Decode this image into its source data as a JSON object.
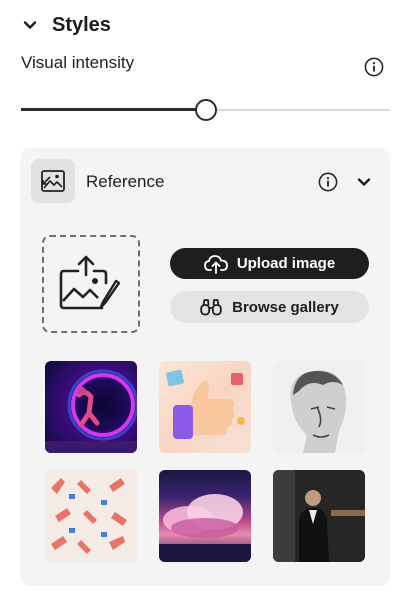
{
  "styles": {
    "title": "Styles",
    "visual_intensity_label": "Visual intensity",
    "slider_value": 0.5
  },
  "reference": {
    "label": "Reference",
    "upload_button": "Upload image",
    "browse_button": "Browse gallery",
    "gallery": [
      {
        "name": "neon-dancer"
      },
      {
        "name": "3d-thumbs-up"
      },
      {
        "name": "sketch-portrait"
      },
      {
        "name": "hand-pattern"
      },
      {
        "name": "pink-clouds"
      },
      {
        "name": "man-in-suit"
      }
    ]
  },
  "colors": {
    "accent_dark": "#1e1e1e",
    "panel_bg": "#f4f4f4",
    "secondary_button": "#e3e3e3"
  },
  "icons": [
    "chevron-down-icon",
    "info-icon",
    "reference-image-icon",
    "upload-image-icon",
    "cloud-upload-icon",
    "binoculars-icon"
  ]
}
